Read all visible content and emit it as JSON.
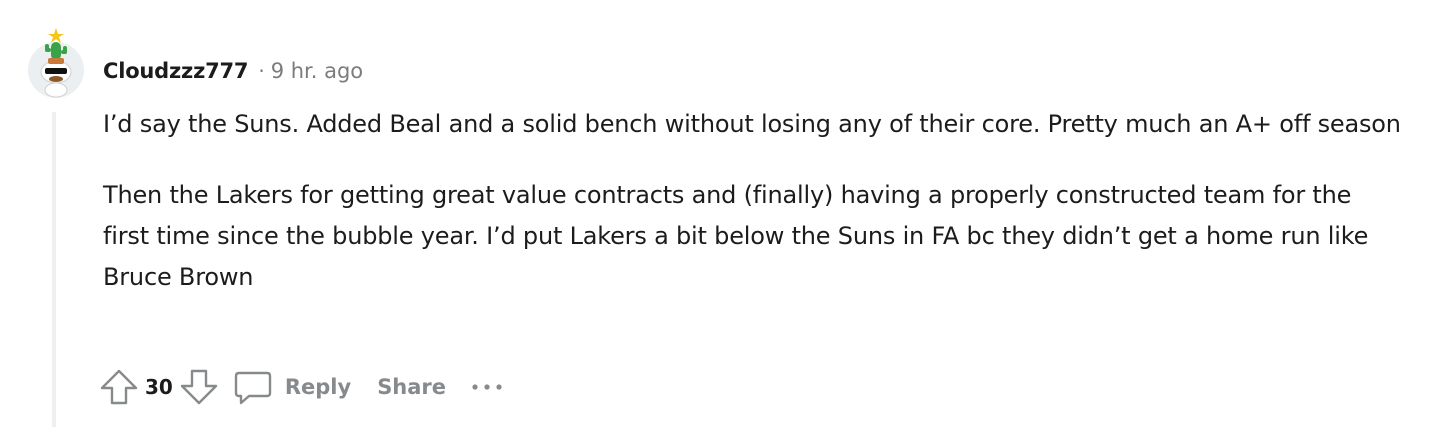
{
  "comment": {
    "username": "Cloudzzz777",
    "separator": "·",
    "timestamp": "9 hr. ago",
    "paragraphs": [
      "I’d say the Suns. Added Beal and a solid bench without losing any of their core. Pretty much an A+ off season",
      "Then the Lakers for getting great value contracts and (finally) having a properly constructed team for the first time since the bubble year. I’d put Lakers a bit below the Suns in FA bc they didn’t get a home run like Bruce Brown"
    ]
  },
  "actions": {
    "score": "30",
    "reply_label": "Reply",
    "share_label": "Share",
    "upvote_icon": "upvote-arrow-icon",
    "downvote_icon": "downvote-arrow-icon",
    "reply_icon": "speech-bubble-icon",
    "more_icon": "ellipsis-icon"
  },
  "colors": {
    "text": "#1c1c1c",
    "muted": "#7c7c7c",
    "action_gray": "#878a8c",
    "thread_line": "#edeff1"
  }
}
